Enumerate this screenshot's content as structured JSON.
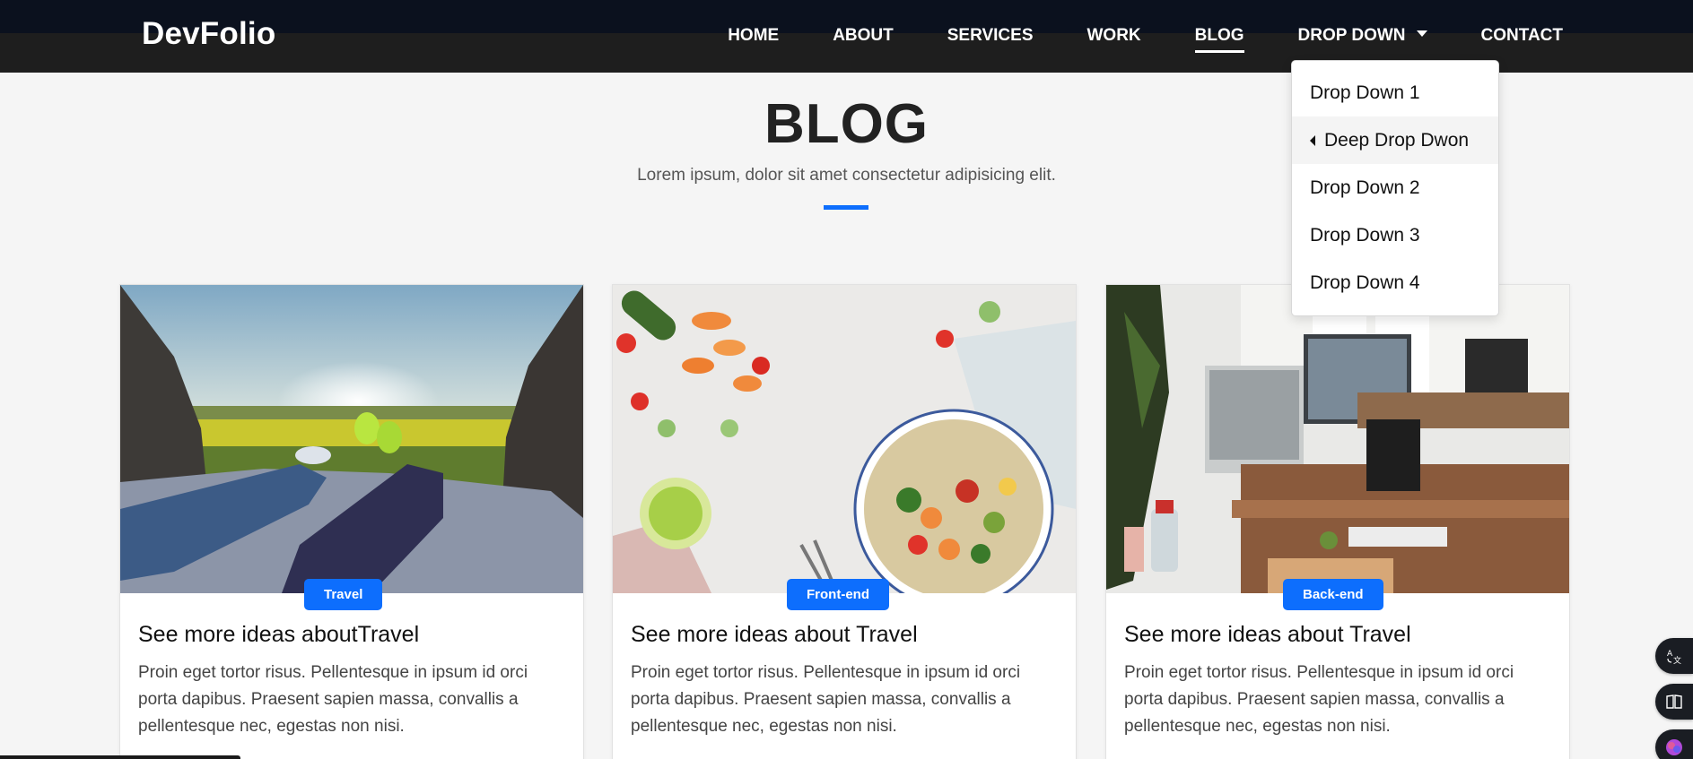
{
  "brand": "DevFolio",
  "nav": {
    "items": [
      "HOME",
      "ABOUT",
      "SERVICES",
      "WORK",
      "BLOG"
    ],
    "dropdown_label": "DROP DOWN",
    "contact": "CONTACT",
    "active": "BLOG"
  },
  "dropdown": {
    "items": [
      "Drop Down 1",
      "Deep Drop Dwon",
      "Drop Down 2",
      "Drop Down 3",
      "Drop Down 4"
    ],
    "highlighted": "Deep Drop Dwon"
  },
  "section": {
    "title": "BLOG",
    "subtitle": "Lorem ipsum, dolor sit amet consectetur adipisicing elit."
  },
  "cards": [
    {
      "badge": "Travel",
      "title": "See more ideas aboutTravel",
      "text": "Proin eget tortor risus. Pellentesque in ipsum id orci porta dapibus. Praesent sapien massa, convallis a pellentesque nec, egestas non nisi."
    },
    {
      "badge": "Front-end",
      "title": "See more ideas about Travel",
      "text": "Proin eget tortor risus. Pellentesque in ipsum id orci porta dapibus. Praesent sapien massa, convallis a pellentesque nec, egestas non nisi."
    },
    {
      "badge": "Back-end",
      "title": "See more ideas about Travel",
      "text": "Proin eget tortor risus. Pellentesque in ipsum id orci porta dapibus. Praesent sapien massa, convallis a pellentesque nec, egestas non nisi."
    }
  ],
  "floating_icons": [
    "translate-icon",
    "book-icon",
    "brain-icon"
  ],
  "colors": {
    "accent": "#0d6efd",
    "nav_bg": "#1e1e1e",
    "page_bg": "#f5f5f5"
  }
}
